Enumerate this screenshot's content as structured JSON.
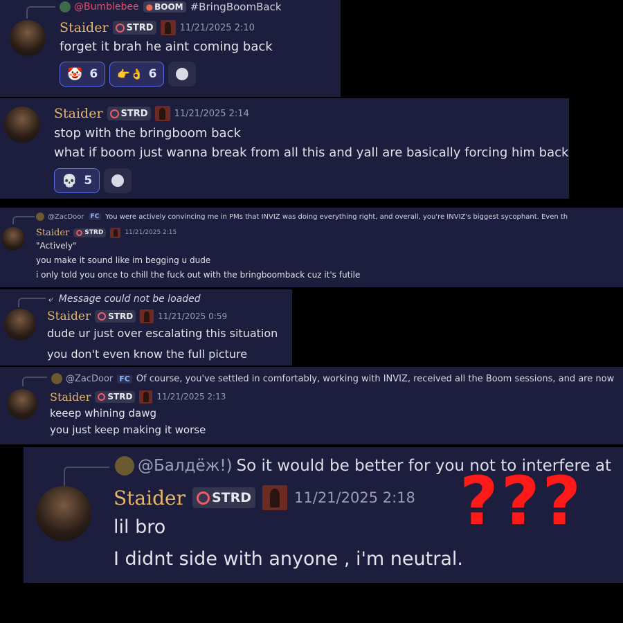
{
  "colors": {
    "panel_bg": "#1d1e3d",
    "username": "#e6b56a",
    "reaction_border": "#5b6ee6",
    "annotation_red": "#ff1a1a"
  },
  "msg1": {
    "reply": {
      "mention": "@Bumblebee",
      "tag": "BOOM",
      "text": "#BringBoomBack"
    },
    "username": "Staider",
    "tag": "STRD",
    "time": "11/21/2025 2:10",
    "lines": [
      "forget it brah he aint coming back"
    ],
    "reactions": [
      {
        "icon": "clown-face-emoji",
        "glyph": "🤡",
        "count": "6"
      },
      {
        "icon": "hand-sign-emoji",
        "glyph": "👉👌",
        "count": "6"
      }
    ]
  },
  "msg2": {
    "username": "Staider",
    "tag": "STRD",
    "time": "11/21/2025 2:14",
    "lines": [
      "stop with the bringboom back",
      "what if boom just wanna break from all this and yall are basically forcing him back"
    ],
    "reactions": [
      {
        "icon": "skull-emoji",
        "glyph": "💀",
        "count": "5"
      }
    ]
  },
  "msg3": {
    "reply": {
      "mention": "@ZacDoor",
      "tag": "FC",
      "text": "You were actively convincing me in PMs that INVIZ was doing everything right, and overall, you're INVIZ's biggest sycophant. Even th"
    },
    "username": "Staider",
    "tag": "STRD",
    "time": "11/21/2025 2:15",
    "lines": [
      "\"Actively\"",
      "you make it sound like im begging u dude",
      "i only told you once to chill the fuck out with the bringboomback cuz it's futile"
    ]
  },
  "msg4": {
    "reply": {
      "text": "Message could not be loaded"
    },
    "username": "Staider",
    "tag": "STRD",
    "time": "11/21/2025 0:59",
    "lines": [
      "dude ur just over escalating this situation",
      "you don't even know the full picture"
    ]
  },
  "msg5": {
    "reply": {
      "mention": "@ZacDoor",
      "tag": "FC",
      "text": "Of course, you've settled in comfortably, working with INVIZ, received all the Boom sessions, and are now"
    },
    "username": "Staider",
    "tag": "STRD",
    "time": "11/21/2025 2:13",
    "lines": [
      "keeep whining dawg",
      "you just keep making it worse"
    ]
  },
  "msg6": {
    "reply": {
      "mention": "@Балдёж!)",
      "text": "So it would be better for you not to interfere at"
    },
    "username": "Staider",
    "tag": "STRD",
    "time": "11/21/2025 2:18",
    "lines": [
      "lil bro",
      "I didnt side with anyone , i'm neutral."
    ]
  },
  "annotation": "???"
}
